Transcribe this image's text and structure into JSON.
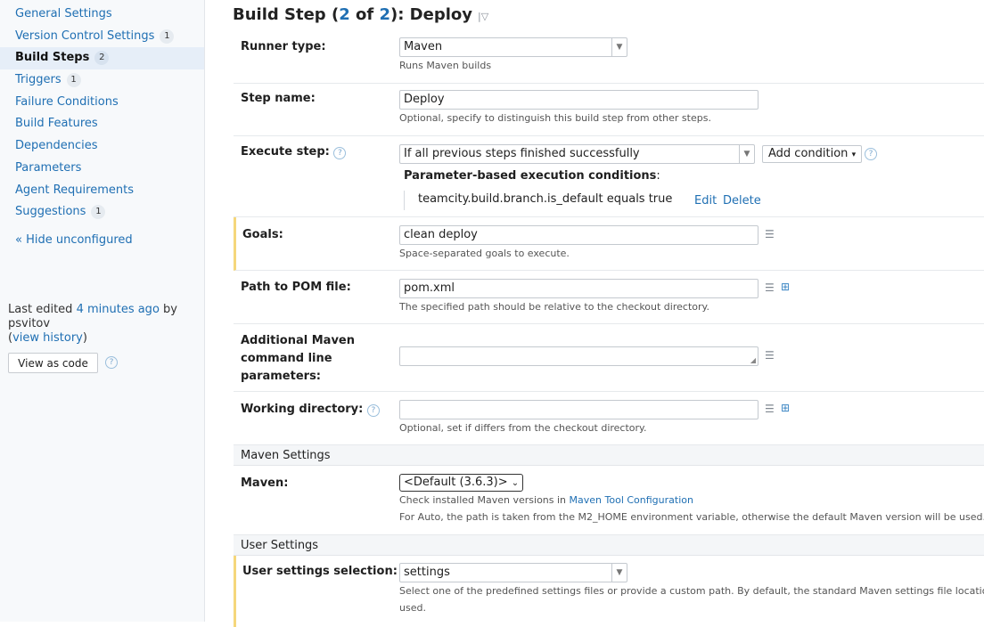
{
  "sidebar": {
    "items": [
      {
        "label": "General Settings",
        "badge": ""
      },
      {
        "label": "Version Control Settings",
        "badge": "1"
      },
      {
        "label": "Build Steps",
        "badge": "2"
      },
      {
        "label": "Triggers",
        "badge": "1"
      },
      {
        "label": "Failure Conditions",
        "badge": ""
      },
      {
        "label": "Build Features",
        "badge": ""
      },
      {
        "label": "Dependencies",
        "badge": ""
      },
      {
        "label": "Parameters",
        "badge": ""
      },
      {
        "label": "Agent Requirements",
        "badge": ""
      },
      {
        "label": "Suggestions",
        "badge": "1"
      }
    ],
    "hide_unconfigured": "« Hide unconfigured",
    "last_edited_prefix": "Last edited",
    "last_edited_time": "4 minutes ago",
    "last_edited_by": "by psvitov",
    "view_history": "view history",
    "view_as_code": "View as code"
  },
  "header": {
    "title_prefix": "Build Step (",
    "step_current": "2",
    "step_of": " of ",
    "step_total": "2",
    "title_suffix": "): Deploy"
  },
  "form": {
    "runner_type": {
      "label": "Runner type:",
      "value": "Maven",
      "note": "Runs Maven builds"
    },
    "step_name": {
      "label": "Step name:",
      "value": "Deploy",
      "note": "Optional, specify to distinguish this build step from other steps."
    },
    "execute_step": {
      "label": "Execute step:",
      "value": "If all previous steps finished successfully",
      "add_condition": "Add condition",
      "conditions_title": "Parameter-based execution conditions",
      "condition": "teamcity.build.branch.is_default equals true",
      "edit": "Edit",
      "delete": "Delete"
    },
    "goals": {
      "label": "Goals:",
      "value": "clean deploy",
      "note": "Space-separated goals to execute."
    },
    "pom": {
      "label": "Path to POM file:",
      "value": "pom.xml",
      "note": "The specified path should be relative to the checkout directory."
    },
    "additional": {
      "label_1": "Additional Maven",
      "label_2": "command line",
      "label_3": "parameters:",
      "value": ""
    },
    "working_dir": {
      "label": "Working directory:",
      "value": "",
      "note": "Optional, set if differs from the checkout directory."
    }
  },
  "maven_settings": {
    "section_title": "Maven Settings",
    "label": "Maven:",
    "value": "<Default (3.6.3)>",
    "note_prefix": "Check installed Maven versions in",
    "note_link": "Maven Tool Configuration",
    "note2": "For Auto, the path is taken from the M2_HOME environment variable, otherwise the default Maven version will be used."
  },
  "user_settings": {
    "section_title": "User Settings",
    "label": "User settings selection:",
    "value": "settings",
    "note_1": "Select one of the predefined settings files or provide a custom path. By default, the standard Maven settings file location is",
    "note_2": "used."
  }
}
